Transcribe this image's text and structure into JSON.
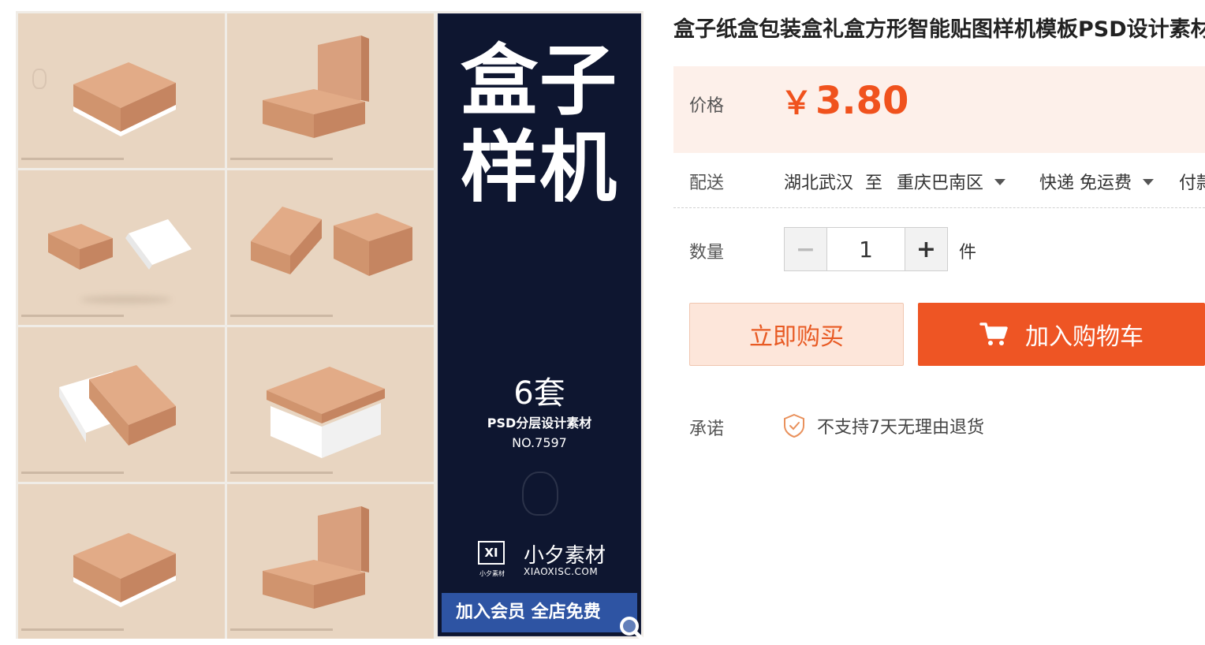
{
  "product": {
    "title": "盒子纸盒包装盒礼盒方形智能贴图样机模板PSD设计素材"
  },
  "gallery": {
    "banner": {
      "line1": "盒子",
      "line2": "样机",
      "set_count": "6套",
      "subtitle": "PSD分层设计素材",
      "number": "NO.7597",
      "brand_logo": "XI",
      "brand_logo_sub": "小夕素材",
      "brand_name": "小夕素材",
      "brand_site": "XIAOXISC.COM",
      "member_text": "加入会员 全店免费"
    },
    "zoom_icon": "magnifier-icon",
    "colors": {
      "tile_bg": "#e8d5c1",
      "box": "#d9a07e",
      "banner_bg": "#0e1630",
      "member_bg": "#2e54a3"
    }
  },
  "price": {
    "label": "价格",
    "currency": "￥",
    "value": "3.80",
    "color": "#f0521d"
  },
  "delivery": {
    "label": "配送",
    "from": "湖北武汉",
    "to_word": "至",
    "destination": "重庆巴南区",
    "method": "快递 免运费",
    "extra": "付款"
  },
  "quantity": {
    "label": "数量",
    "minus": "−",
    "value": "1",
    "plus": "+",
    "unit": "件"
  },
  "actions": {
    "buy_now": "立即购买",
    "add_to_cart": "加入购物车",
    "accent": "#ee5524"
  },
  "promise": {
    "label": "承诺",
    "text": "不支持7天无理由退货",
    "icon": "shield-check-icon"
  }
}
